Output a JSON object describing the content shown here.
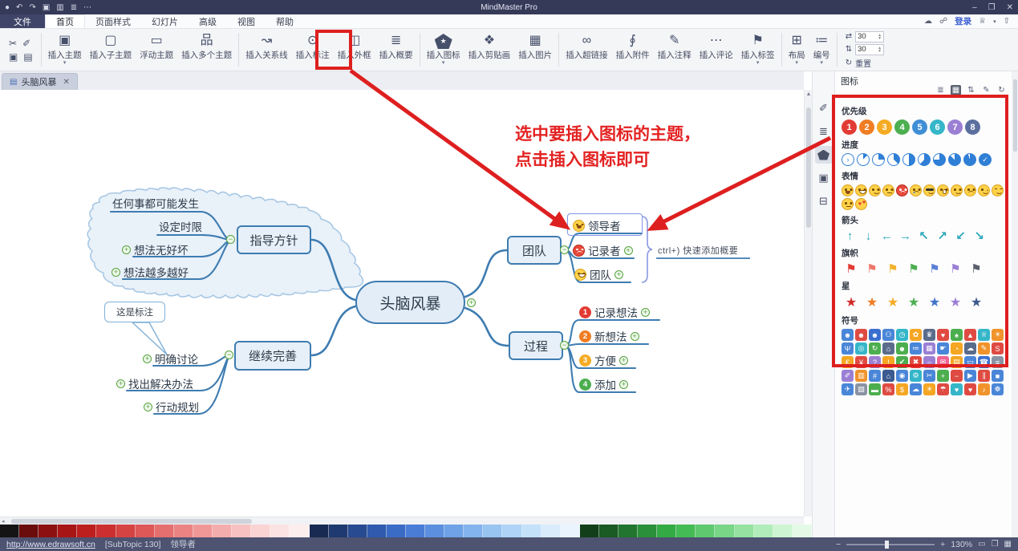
{
  "window": {
    "title": "MindMaster Pro",
    "quick_access": [
      {
        "key": "app-logo-icon",
        "glyph": "●"
      },
      {
        "key": "undo-icon",
        "glyph": "↶"
      },
      {
        "key": "redo-icon",
        "glyph": "↷"
      },
      {
        "key": "save-icon",
        "glyph": "▣"
      },
      {
        "key": "print-icon",
        "glyph": "▥"
      },
      {
        "key": "outline-icon",
        "glyph": "≣"
      },
      {
        "key": "more-icon",
        "glyph": "⋯"
      }
    ],
    "controls": [
      {
        "key": "minimize-button",
        "glyph": "–"
      },
      {
        "key": "restore-button",
        "glyph": "❐"
      },
      {
        "key": "close-button",
        "glyph": "✕"
      }
    ]
  },
  "menu": {
    "file_label": "文件",
    "tabs": [
      {
        "key": "home",
        "label": "首页",
        "active": true
      },
      {
        "key": "page-style",
        "label": "页面样式"
      },
      {
        "key": "slideshow",
        "label": "幻灯片"
      },
      {
        "key": "advanced",
        "label": "高级"
      },
      {
        "key": "view",
        "label": "视图"
      },
      {
        "key": "help",
        "label": "帮助"
      }
    ],
    "right_icons": [
      {
        "key": "cloud-icon",
        "glyph": "☁"
      },
      {
        "key": "share-icon",
        "glyph": "☍"
      }
    ],
    "login_label": "登录",
    "right_icons2": [
      {
        "key": "vip-icon",
        "glyph": "♕"
      },
      {
        "key": "caret-down-icon",
        "glyph": "▾"
      },
      {
        "key": "upgrade-icon",
        "glyph": "⇧"
      }
    ]
  },
  "ribbon": {
    "clipboard": [
      {
        "key": "cut-icon",
        "glyph": "✂"
      },
      {
        "key": "format-painter-icon",
        "glyph": "✐"
      },
      {
        "key": "copy-icon",
        "glyph": "▣"
      },
      {
        "key": "paste-icon",
        "glyph": "▤"
      }
    ],
    "groups": [
      [
        {
          "key": "insert-topic",
          "label": "插入主题",
          "icon": "▣",
          "caret": true
        },
        {
          "key": "insert-subtopic",
          "label": "插入子主题",
          "icon": "▢"
        },
        {
          "key": "floating-topic",
          "label": "浮动主题",
          "icon": "▭"
        },
        {
          "key": "insert-multiple-topics",
          "label": "插入多个主题",
          "icon": "品"
        }
      ],
      [
        {
          "key": "insert-relationship",
          "label": "插入关系线",
          "icon": "↝"
        },
        {
          "key": "insert-callout",
          "label": "插入标注",
          "icon": "⊙"
        },
        {
          "key": "insert-boundary",
          "label": "插入外框",
          "icon": "◫"
        },
        {
          "key": "insert-summary",
          "label": "插入概要",
          "icon": "≣"
        }
      ],
      [
        {
          "key": "insert-icon",
          "label": "插入图标",
          "caret": true
        },
        {
          "key": "insert-clipart",
          "label": "插入剪贴画",
          "icon": "❖"
        },
        {
          "key": "insert-picture",
          "label": "插入图片",
          "icon": "▦"
        }
      ],
      [
        {
          "key": "insert-hyperlink",
          "label": "插入超链接",
          "icon": "∞"
        },
        {
          "key": "insert-attachment",
          "label": "插入附件",
          "icon": "∮"
        },
        {
          "key": "insert-note",
          "label": "插入注释",
          "icon": "✎"
        },
        {
          "key": "insert-comment",
          "label": "插入评论",
          "icon": "⋯"
        },
        {
          "key": "insert-tag",
          "label": "插入标签",
          "icon": "⚑",
          "caret": true
        }
      ],
      [
        {
          "key": "layout",
          "label": "布局",
          "icon": "⊞",
          "caret": true
        },
        {
          "key": "numbering",
          "label": "编号",
          "icon": "≔",
          "caret": true
        }
      ]
    ],
    "spacing": {
      "h_icon": "⇄",
      "v_icon": "⇅",
      "h_value": "30",
      "v_value": "30",
      "reset_icon": "↻",
      "reset_label": "重置"
    }
  },
  "doc_tab": {
    "label": "头脑风暴"
  },
  "mindmap": {
    "center": "头脑风暴",
    "branches": [
      {
        "key": "guide",
        "label": "指导方针",
        "subs": [
          {
            "label": "任何事都可能发生"
          },
          {
            "label": "设定时限"
          },
          {
            "label": "想法无好坏",
            "plus": true
          },
          {
            "label": "想法越多越好",
            "plus": true
          }
        ]
      },
      {
        "key": "improve",
        "label": "继续完善",
        "callout": "这是标注",
        "subs": [
          {
            "label": "明确讨论",
            "plus": true
          },
          {
            "label": "找出解决办法",
            "plus": true
          },
          {
            "label": "行动规划",
            "plus": true
          }
        ]
      },
      {
        "key": "team",
        "label": "团队",
        "summary_tip": "ctrl+) 快速添加概要",
        "subs": [
          {
            "label": "领导者",
            "emoji": "open",
            "selected": true
          },
          {
            "label": "记录者",
            "emoji": "angry",
            "plus": true
          },
          {
            "label": "团队",
            "emoji": "grin",
            "plus": true
          }
        ]
      },
      {
        "key": "process",
        "label": "过程",
        "subs": [
          {
            "label": "记录想法",
            "badge": "1",
            "badge_color": "#e23b33",
            "plus": true
          },
          {
            "label": "新想法",
            "badge": "2",
            "badge_color": "#ef7d23",
            "plus": true
          },
          {
            "label": "方便",
            "badge": "3",
            "badge_color": "#f5ab24",
            "plus": true
          },
          {
            "label": "添加",
            "badge": "4",
            "badge_color": "#4cae4f",
            "plus": true
          }
        ]
      }
    ]
  },
  "annotation": {
    "line1": "选中要插入图标的主题，",
    "line2": "点击插入图标即可",
    "color": "#e32222"
  },
  "icon_panel": {
    "title": "图标",
    "header_icons": [
      {
        "key": "list-view-icon",
        "glyph": "≣"
      },
      {
        "key": "grid-view-icon",
        "glyph": "▦",
        "active": true
      },
      {
        "key": "sort-icon",
        "glyph": "⇅"
      },
      {
        "key": "edit-icon",
        "glyph": "✎"
      },
      {
        "key": "refresh-icon",
        "glyph": "↻"
      }
    ],
    "sections": {
      "priority": {
        "label": "优先级",
        "colors": [
          "#e23b33",
          "#ef7d23",
          "#f5ab24",
          "#4caf50",
          "#3f8fd6",
          "#35b6c9",
          "#9b7fd4",
          "#5b6f9e"
        ]
      },
      "progress": {
        "label": "进度",
        "items": [
          "start",
          12,
          25,
          37,
          50,
          62,
          75,
          87,
          95,
          "check"
        ]
      },
      "emoji": {
        "label": "表情",
        "variants": [
          "open",
          "grin",
          "smile",
          "flat",
          "angry",
          "cry",
          "cool",
          "shock",
          "smile",
          "frown",
          "wink",
          "sleepy",
          "flat",
          "love"
        ]
      },
      "arrows": {
        "label": "箭头",
        "color": "#2aa7b8",
        "chars": [
          "↑",
          "↓",
          "←",
          "→",
          "↖",
          "↗",
          "↙",
          "↘"
        ]
      },
      "flags": {
        "label": "旗帜",
        "colors": [
          "#e23b33",
          "#f0776b",
          "#f2b12c",
          "#4cae4f",
          "#5b7fd6",
          "#9b7fd4",
          "#5a5f6b"
        ]
      },
      "stars": {
        "label": "星",
        "colors": [
          "#cf2c28",
          "#ef7d23",
          "#f5ab24",
          "#4caf50",
          "#3f74c9",
          "#9b7fd4",
          "#3c5a8f"
        ]
      },
      "symbols": {
        "label": "符号",
        "items": [
          [
            "☻",
            "#4a86d8"
          ],
          [
            "☻",
            "#df4b42"
          ],
          [
            "☻",
            "#3a6fd0"
          ],
          [
            "⚇",
            "#4a86d8"
          ],
          [
            "◷",
            "#35b6c9"
          ],
          [
            "✿",
            "#f5a623"
          ],
          [
            "♛",
            "#5a6c8c"
          ],
          [
            "♥",
            "#df4b42"
          ],
          [
            "♠",
            "#4cae4f"
          ],
          [
            "▲",
            "#df4b42"
          ],
          [
            "♕",
            "#35b6c9"
          ],
          [
            "☀",
            "#f0932b"
          ],
          [
            "Ψ",
            "#4a86d8"
          ],
          [
            "◎",
            "#35b6c9"
          ],
          [
            "↻",
            "#4cae4f"
          ],
          [
            "⌂",
            "#5a6c8c"
          ],
          [
            "☻",
            "#4cae4f"
          ],
          [
            "≔",
            "#4a86d8"
          ],
          [
            "▦",
            "#9b7fd4"
          ],
          [
            "☛",
            "#4a86d8"
          ],
          [
            "◔",
            "#f5a623"
          ],
          [
            "☁",
            "#5a6c8c"
          ],
          [
            "✎",
            "#f0932b"
          ],
          [
            "S",
            "#df4b42"
          ],
          [
            "€",
            "#f5a623"
          ],
          [
            "¥",
            "#df4b42"
          ],
          [
            "?",
            "#9b7fd4"
          ],
          [
            "!",
            "#f5a623"
          ],
          [
            "✔",
            "#4cae4f"
          ],
          [
            "✖",
            "#df4b42"
          ],
          [
            "☼",
            "#9b7fd4"
          ],
          [
            "✉",
            "#ef6292"
          ],
          [
            "▤",
            "#f5a623"
          ],
          [
            "▭",
            "#4a86d8"
          ],
          [
            "☎",
            "#3a6fd0"
          ],
          [
            "≡",
            "#8a93a3"
          ],
          [
            "✐",
            "#9b7fd4"
          ],
          [
            "▥",
            "#f0932b"
          ],
          [
            "#",
            "#4a86d8"
          ],
          [
            "⌂",
            "#3c5a8f"
          ],
          [
            "◉",
            "#4a86d8"
          ],
          [
            "⚙",
            "#35b6c9"
          ],
          [
            "✂",
            "#4a86d8"
          ],
          [
            "+",
            "#4cae4f"
          ],
          [
            "−",
            "#df4b42"
          ],
          [
            "▶",
            "#4a86d8"
          ],
          [
            "∥",
            "#df4b42"
          ],
          [
            "■",
            "#4a86d8"
          ],
          [
            "✈",
            "#4a86d8"
          ],
          [
            "▧",
            "#8a93a3"
          ],
          [
            "▬",
            "#4cae4f"
          ],
          [
            "%",
            "#df4b42"
          ],
          [
            "$",
            "#f5a623"
          ],
          [
            "☁",
            "#4a86d8"
          ],
          [
            "☀",
            "#f5a623"
          ],
          [
            "☂",
            "#df4b42"
          ],
          [
            "♥",
            "#35b6c9"
          ],
          [
            "♥",
            "#df4b42"
          ],
          [
            "♪",
            "#f0932b"
          ],
          [
            "☸",
            "#4a86d8"
          ]
        ]
      }
    }
  },
  "sidebar_tools": [
    {
      "key": "sidebar-tool-style",
      "glyph": "✐"
    },
    {
      "key": "sidebar-tool-outline",
      "glyph": "≣"
    },
    {
      "key": "sidebar-tool-icon",
      "glyph": "",
      "active": true
    },
    {
      "key": "sidebar-tool-clipart",
      "glyph": "▣"
    },
    {
      "key": "sidebar-tool-task",
      "glyph": "⊟"
    }
  ],
  "palette": {
    "colors": [
      "#141414",
      "#6a0c0c",
      "#8c1010",
      "#a81515",
      "#bd1f1f",
      "#cb2f2f",
      "#d54343",
      "#de5858",
      "#e56e6e",
      "#eb8383",
      "#f09898",
      "#f4adad",
      "#f7c1c1",
      "#fad3d3",
      "#fce3e3",
      "#fdeeee",
      "#182a52",
      "#1f3a70",
      "#274a90",
      "#2f5aae",
      "#3a6cc6",
      "#4a7ed6",
      "#5c90de",
      "#6fa2e6",
      "#83b4ed",
      "#98c4f2",
      "#aed3f6",
      "#c4e1fa",
      "#d8ecfc",
      "#e9f4fe",
      "#123f19",
      "#1a5a23",
      "#22752e",
      "#2a9039",
      "#33aa44",
      "#44bb55",
      "#5ec96e",
      "#79d687",
      "#95e2a1",
      "#b1edba",
      "#cdf5d2",
      "#e4fae6"
    ]
  },
  "status_bar": {
    "link": "http://www.edrawsoft.cn",
    "doc_info": "[SubTopic 130]",
    "selection": "领导者",
    "zoom_minus": "−",
    "zoom_plus": "+",
    "zoom_level": "130%",
    "icons": [
      {
        "key": "view-normal-icon",
        "glyph": "▭"
      },
      {
        "key": "view-fit-icon",
        "glyph": "❐"
      },
      {
        "key": "view-full-icon",
        "glyph": "▦"
      }
    ]
  }
}
